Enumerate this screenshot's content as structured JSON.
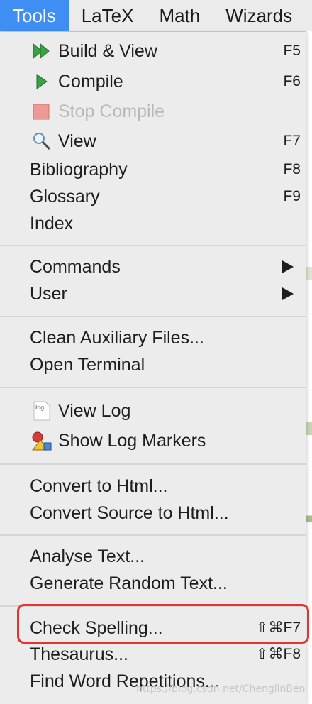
{
  "menubar": {
    "items": [
      "Tools",
      "LaTeX",
      "Math",
      "Wizards"
    ]
  },
  "menu": {
    "group1": {
      "build_view": {
        "label": "Build & View",
        "shortcut": "F5",
        "icon": "fast-forward-icon"
      },
      "compile": {
        "label": "Compile",
        "shortcut": "F6",
        "icon": "play-icon"
      },
      "stop_compile": {
        "label": "Stop Compile",
        "icon": "stop-icon",
        "enabled": false
      },
      "view": {
        "label": "View",
        "shortcut": "F7",
        "icon": "magnifier-icon"
      },
      "bibliography": {
        "label": "Bibliography",
        "shortcut": "F8"
      },
      "glossary": {
        "label": "Glossary",
        "shortcut": "F9"
      },
      "index": {
        "label": "Index"
      }
    },
    "group2": {
      "commands": {
        "label": "Commands"
      },
      "user": {
        "label": "User"
      }
    },
    "group3": {
      "clean": {
        "label": "Clean Auxiliary Files..."
      },
      "terminal": {
        "label": "Open Terminal"
      }
    },
    "group4": {
      "view_log": {
        "label": "View Log",
        "icon": "log-file-icon"
      },
      "log_markers": {
        "label": "Show Log Markers",
        "icon": "log-markers-icon"
      }
    },
    "group5": {
      "convert_html": {
        "label": "Convert to Html..."
      },
      "convert_source": {
        "label": "Convert Source to Html..."
      }
    },
    "group6": {
      "analyse": {
        "label": "Analyse Text..."
      },
      "random_text": {
        "label": "Generate Random Text..."
      }
    },
    "group7": {
      "check_spelling": {
        "label": "Check Spelling...",
        "shortcut": "⇧⌘F7"
      },
      "thesaurus": {
        "label": "Thesaurus...",
        "shortcut": "⇧⌘F8"
      },
      "word_repetitions": {
        "label": "Find Word Repetitions..."
      }
    }
  },
  "watermark": "https://blog.csdn.net/ChenglinBen",
  "colors": {
    "accent": "#3f8ef3",
    "highlight_border": "#e3352f"
  }
}
